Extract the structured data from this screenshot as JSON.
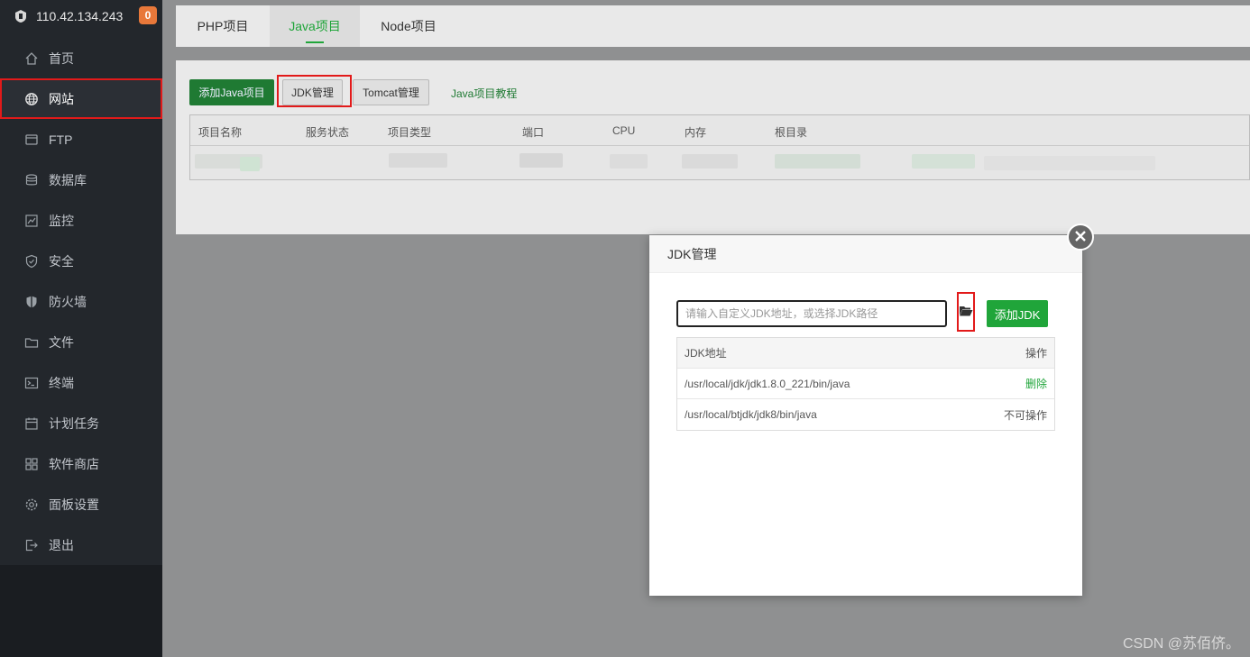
{
  "sidebar": {
    "server_ip": "110.42.134.243",
    "badge_count": "0",
    "items": [
      {
        "label": "首页",
        "icon": "home-icon"
      },
      {
        "label": "网站",
        "icon": "globe-icon",
        "active": true
      },
      {
        "label": "FTP",
        "icon": "ftp-icon"
      },
      {
        "label": "数据库",
        "icon": "database-icon"
      },
      {
        "label": "监控",
        "icon": "monitor-icon"
      },
      {
        "label": "安全",
        "icon": "shield-check-icon"
      },
      {
        "label": "防火墙",
        "icon": "firewall-icon"
      },
      {
        "label": "文件",
        "icon": "folder-icon"
      },
      {
        "label": "终端",
        "icon": "terminal-icon"
      },
      {
        "label": "计划任务",
        "icon": "calendar-icon"
      },
      {
        "label": "软件商店",
        "icon": "apps-icon"
      },
      {
        "label": "面板设置",
        "icon": "gear-icon"
      },
      {
        "label": "退出",
        "icon": "logout-icon"
      }
    ]
  },
  "tabs": [
    {
      "label": "PHP项目"
    },
    {
      "label": "Java项目",
      "active": true
    },
    {
      "label": "Node项目"
    }
  ],
  "toolbar": {
    "add_java": "添加Java项目",
    "jdk_manage": "JDK管理",
    "tomcat_manage": "Tomcat管理",
    "java_tutorial": "Java项目教程"
  },
  "project_table": {
    "columns": [
      "项目名称",
      "服务状态",
      "项目类型",
      "端口",
      "CPU",
      "内存",
      "根目录"
    ]
  },
  "dialog": {
    "title": "JDK管理",
    "input_placeholder": "请输入自定义JDK地址，或选择JDK路径",
    "add_button": "添加JDK",
    "columns": {
      "path": "JDK地址",
      "action": "操作"
    },
    "rows": [
      {
        "path": "/usr/local/jdk/jdk1.8.0_221/bin/java",
        "action": "删除"
      },
      {
        "path": "/usr/local/btjdk/jdk8/bin/java",
        "action": "不可操作"
      }
    ]
  },
  "watermark": "CSDN @苏佰侪。",
  "colors": {
    "accent": "#20a53a",
    "highlight": "#e21a1a",
    "badge": "#e8783a"
  }
}
